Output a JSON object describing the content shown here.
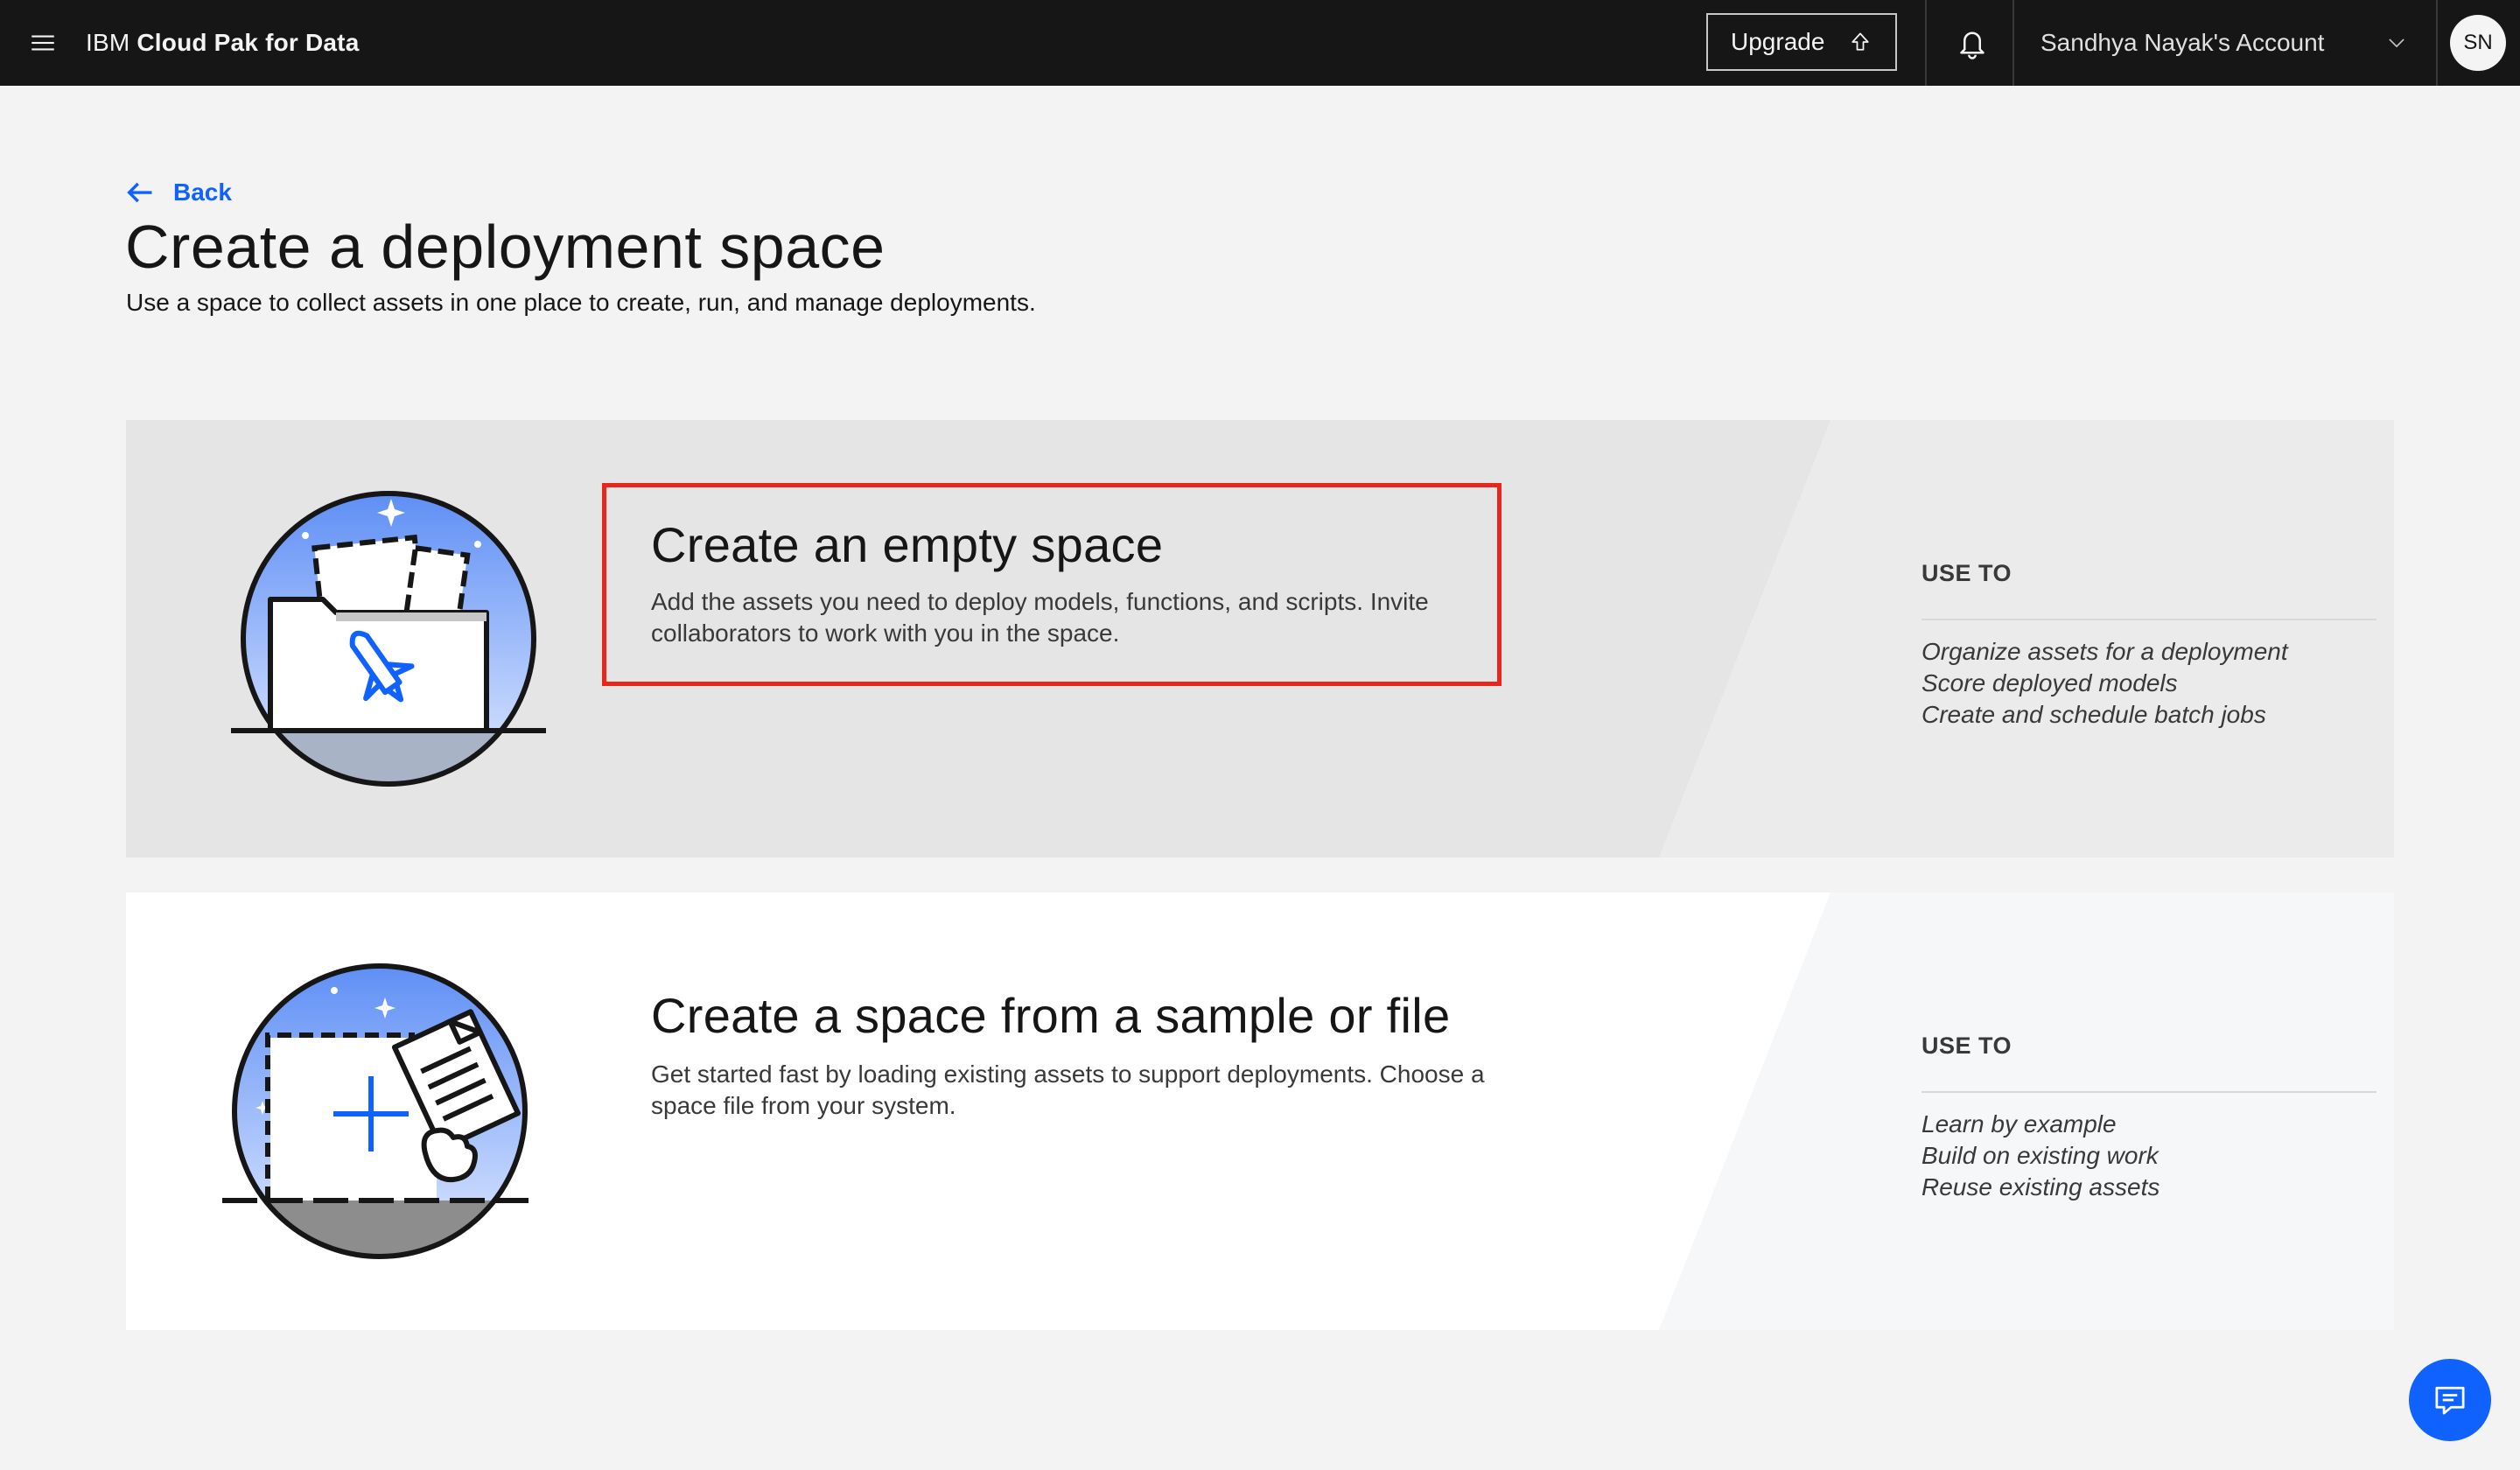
{
  "header": {
    "brand_prefix": "IBM",
    "brand_product": "Cloud Pak for Data",
    "upgrade_label": "Upgrade",
    "account_label": "Sandhya Nayak's Account",
    "avatar_initials": "SN"
  },
  "page": {
    "back_label": "Back",
    "title": "Create a deployment space",
    "subtitle": "Use a space to collect assets in one place to create, run, and manage deployments."
  },
  "cards": [
    {
      "title": "Create an empty space",
      "description": "Add the assets you need to deploy models, functions, and scripts. Invite collaborators to work with you in the space.",
      "use_to_heading": "USE TO",
      "use_to_items": [
        "Organize assets for a deployment",
        "Score deployed models",
        "Create and schedule batch jobs"
      ]
    },
    {
      "title": "Create a space from a sample or file",
      "description": "Get started fast by loading existing assets to support deployments. Choose a space file from your system.",
      "use_to_heading": "USE TO",
      "use_to_items": [
        "Learn by example",
        "Build on existing work",
        "Reuse existing assets"
      ]
    }
  ],
  "colors": {
    "accent": "#0f62fe",
    "highlight_border": "#e8261b",
    "header_bg": "#161616"
  }
}
